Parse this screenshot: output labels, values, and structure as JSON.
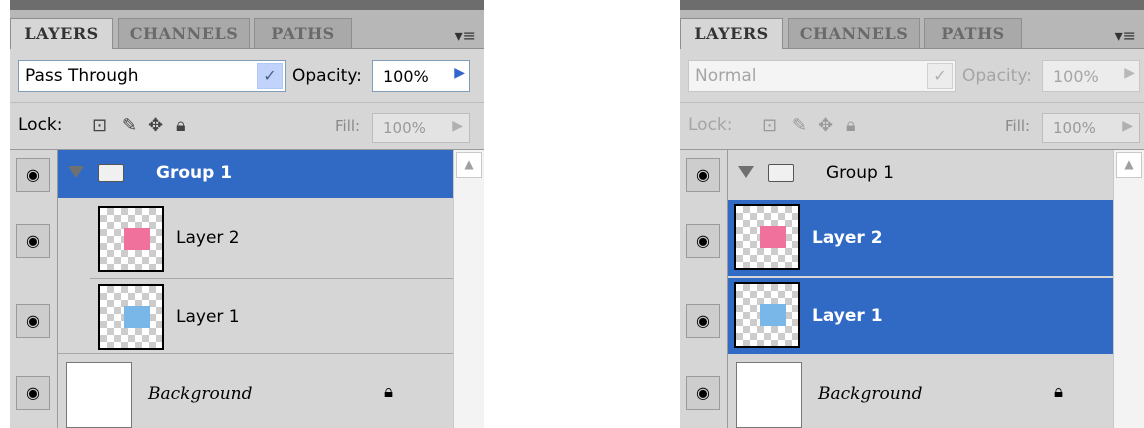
{
  "colors": {
    "selection": "#316ac5",
    "layer2_swatch": "#f0719c",
    "layer1_swatch": "#79b7e8"
  },
  "panels": [
    {
      "tabs": [
        "LAYERS",
        "CHANNELS",
        "PATHS"
      ],
      "menu_icon": "panel-menu-icon",
      "blend_mode": "Pass Through",
      "opacity_label": "Opacity:",
      "opacity_value": "100%",
      "lock_label": "Lock:",
      "fill_label": "Fill:",
      "fill_value": "100%",
      "layers": [
        {
          "name": "Group 1",
          "type": "group",
          "selected": true
        },
        {
          "name": "Layer 2",
          "type": "layer",
          "selected": false
        },
        {
          "name": "Layer 1",
          "type": "layer",
          "selected": false
        },
        {
          "name": "Background",
          "type": "background",
          "selected": false
        }
      ]
    },
    {
      "tabs": [
        "LAYERS",
        "CHANNELS",
        "PATHS"
      ],
      "menu_icon": "panel-menu-icon",
      "blend_mode": "Normal",
      "opacity_label": "Opacity:",
      "opacity_value": "100%",
      "lock_label": "Lock:",
      "fill_label": "Fill:",
      "fill_value": "100%",
      "layers": [
        {
          "name": "Group 1",
          "type": "group",
          "selected": false
        },
        {
          "name": "Layer 2",
          "type": "layer",
          "selected": true
        },
        {
          "name": "Layer 1",
          "type": "layer",
          "selected": true
        },
        {
          "name": "Background",
          "type": "background",
          "selected": false
        }
      ]
    }
  ]
}
